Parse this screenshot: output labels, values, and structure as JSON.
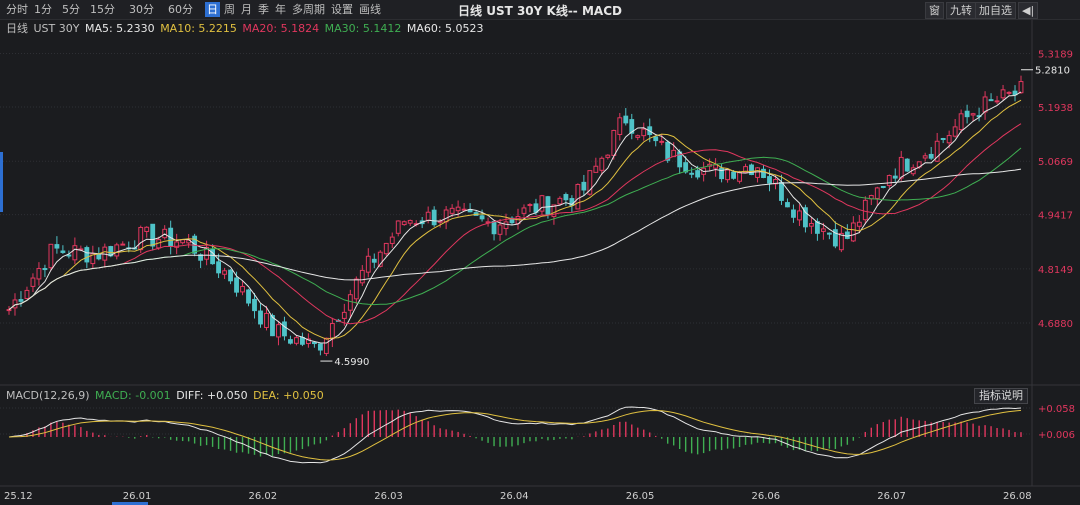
{
  "toolbar": {
    "periods": [
      "分时",
      "1分",
      "5分",
      "15分",
      "30分",
      "60分",
      "日",
      "周",
      "月",
      "季",
      "年",
      "多周期",
      "设置",
      "画线"
    ],
    "active_period": "日",
    "title": "日线 UST 30Y   K线-- MACD",
    "right_icon_1": "窗",
    "nine_turn": "九转",
    "add_watch": "加自选"
  },
  "legend": {
    "period": "日线",
    "symbol": "UST 30Y",
    "ma5_label": "MA5: 5.2330",
    "ma10_label": "MA10: 5.2215",
    "ma20_label": "MA20: 5.1824",
    "ma30_label": "MA30: 5.1412",
    "ma60_label": "MA60: 5.0523"
  },
  "macd_legend": {
    "params": "MACD(12,26,9)",
    "macd_label": "MACD: -0.001",
    "diff_label": "DIFF: +0.050",
    "dea_label": "DEA: +0.050",
    "help": "指标说明"
  },
  "colors": {
    "up": "#e0375e",
    "down": "#4fc3c8",
    "ma5": "#e6e6e6",
    "ma10": "#e0c040",
    "ma20": "#e0375e",
    "ma30": "#3fae52",
    "ma60": "#e6e6e6",
    "diff": "#e6e6e6",
    "dea": "#e0c040",
    "price_label": "#e0375e",
    "grid": "#2e2f34"
  },
  "chart_data": {
    "type": "candlestick",
    "price_axis_ticks": [
      "5.3189",
      "5.1938",
      "5.0669",
      "4.9417",
      "4.8149",
      "4.6880"
    ],
    "ylim": [
      4.55,
      5.36
    ],
    "x_tick_labels": [
      "25.12",
      "26.01",
      "26.02",
      "26.03",
      "26.04",
      "26.05",
      "26.06",
      "26.07",
      "26.08"
    ],
    "high_marker": "5.2810",
    "low_marker": "4.5990",
    "monthly_path": [
      [
        "25.12",
        4.72
      ],
      [
        "12-15",
        4.86
      ],
      [
        "26.01",
        4.85
      ],
      [
        "01-20",
        4.89
      ],
      [
        "26.02",
        4.88
      ],
      [
        "02-10",
        4.8
      ],
      [
        "02-20",
        4.67
      ],
      [
        "26.03",
        4.63
      ],
      [
        "03-12",
        4.8
      ],
      [
        "03-25",
        4.93
      ],
      [
        "26.04",
        4.94
      ],
      [
        "04-15",
        4.92
      ],
      [
        "04-28",
        4.96
      ],
      [
        "26.05",
        4.99
      ],
      [
        "05-12",
        5.17
      ],
      [
        "05-22",
        5.08
      ],
      [
        "26.06",
        5.04
      ],
      [
        "06-12",
        5.06
      ],
      [
        "06-22",
        4.94
      ],
      [
        "26.07",
        4.88
      ],
      [
        "07-10",
        5.04
      ],
      [
        "07-22",
        5.1
      ],
      [
        "26.08",
        5.19
      ],
      [
        "08-06",
        5.23
      ]
    ],
    "macd_axis_ticks": [
      "+0.058",
      "+0.006"
    ],
    "macd_ylim": [
      -0.09,
      0.07
    ],
    "diff_end": 0.05,
    "dea_end": 0.05,
    "macd_end": -0.001
  }
}
